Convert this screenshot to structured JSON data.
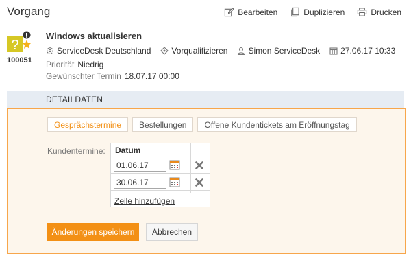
{
  "header": {
    "title": "Vorgang",
    "actions": [
      {
        "label": "Bearbeiten",
        "icon": "edit-icon"
      },
      {
        "label": "Duplizieren",
        "icon": "duplicate-icon"
      },
      {
        "label": "Drucken",
        "icon": "print-icon"
      }
    ]
  },
  "ticket": {
    "id": "100051",
    "title": "Windows aktualisieren",
    "meta": [
      {
        "label": "ServiceDesk Deutschland",
        "icon": "gear-icon"
      },
      {
        "label": "Vorqualifizieren",
        "icon": "workflow-icon"
      },
      {
        "label": "Simon ServiceDesk",
        "icon": "user-icon"
      },
      {
        "label": "27.06.17 10:33",
        "icon": "calendar-icon"
      }
    ],
    "priority_label": "Priorität",
    "priority_value": "Niedrig",
    "due_label": "Gewünschter Termin",
    "due_value": "18.07.17 00:00"
  },
  "section": {
    "title": "DETAILDATEN"
  },
  "tabs": [
    {
      "label": "Gesprächstermine",
      "active": true
    },
    {
      "label": "Bestellungen",
      "active": false
    },
    {
      "label": "Offene Kundentickets am Eröffnungstag",
      "active": false
    }
  ],
  "appointments": {
    "label": "Kundentermine:",
    "column_header": "Datum",
    "rows": [
      {
        "date": "01.06.17"
      },
      {
        "date": "30.06.17"
      }
    ],
    "add_row_label": "Zeile hinzufügen"
  },
  "buttons": {
    "save": "Änderungen speichern",
    "cancel": "Abbrechen"
  },
  "colors": {
    "accent": "#f39015",
    "panel_border": "#f7a64b",
    "section_bar": "#e6ecf3"
  }
}
